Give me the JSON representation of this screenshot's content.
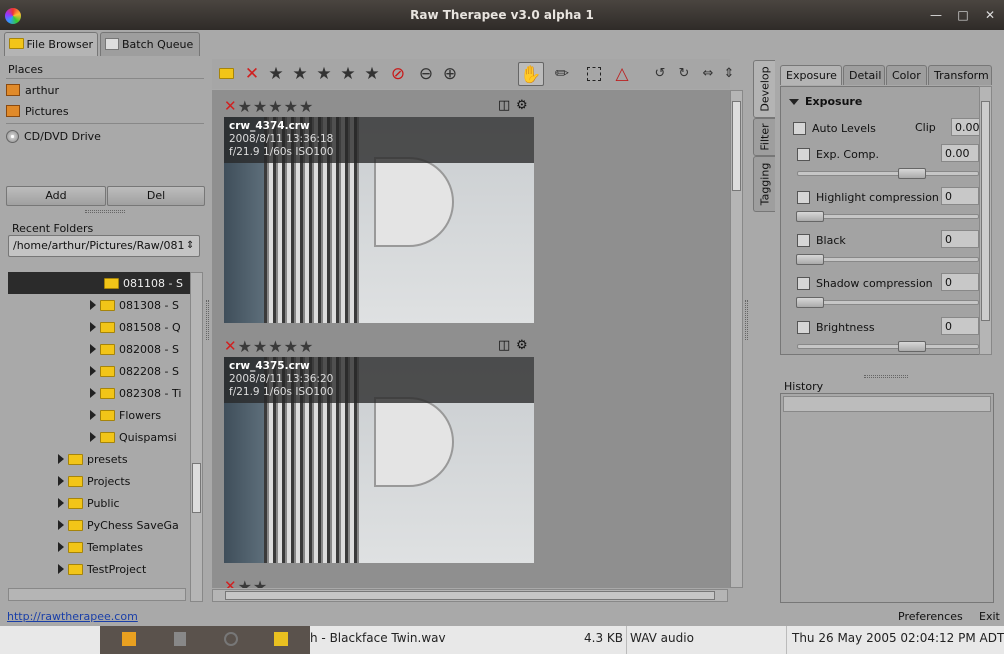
{
  "window": {
    "title": "Raw Therapee v3.0 alpha 1"
  },
  "tabs": {
    "file_browser": "File Browser",
    "batch_queue": "Batch Queue"
  },
  "places": {
    "header": "Places",
    "items": [
      "arthur",
      "Pictures",
      "CD/DVD Drive"
    ],
    "add_label": "Add",
    "del_label": "Del"
  },
  "recent": {
    "header": "Recent Folders",
    "value": "/home/arthur/Pictures/Raw/081"
  },
  "tree": {
    "items": [
      "081108 - S",
      "081308 - S",
      "081508 - Q",
      "082008 - S",
      "082208 - S",
      "082308 - Ti",
      "Flowers",
      "Quispamsi",
      "presets",
      "Projects",
      "Public",
      "PyChess SaveGa",
      "Templates",
      "TestProject"
    ]
  },
  "thumbs": [
    {
      "name": "crw_4374.crw",
      "date": "2008/8/11 13:36:18",
      "exif": "f/21.9 1/60s ISO100"
    },
    {
      "name": "crw_4375.crw",
      "date": "2008/8/11 13:36:20",
      "exif": "f/21.9 1/60s ISO100"
    }
  ],
  "side_tabs": {
    "develop": "Develop",
    "filter": "Filter",
    "tagging": "Tagging"
  },
  "tool_tabs": {
    "exposure": "Exposure",
    "detail": "Detail",
    "color": "Color",
    "transform": "Transform"
  },
  "exposure": {
    "header": "Exposure",
    "auto_levels": "Auto Levels",
    "clip_label": "Clip",
    "clip_value": "0.00",
    "exp_comp": "Exp. Comp.",
    "exp_comp_value": "0.00",
    "highlight": "Highlight compression",
    "highlight_value": "0",
    "black": "Black",
    "black_value": "0",
    "shadow": "Shadow compression",
    "shadow_value": "0",
    "brightness": "Brightness",
    "brightness_value": "0"
  },
  "history": {
    "header": "History"
  },
  "status": {
    "link": "http://rawtherapee.com",
    "preferences": "Preferences",
    "exit": "Exit"
  },
  "taskbar": {
    "file": "h - Blackface Twin.wav",
    "size": "4.3 KB",
    "type": "WAV audio",
    "date": "Thu 26 May 2005 02:04:12 PM ADT"
  },
  "colors": {
    "accent": "#3a6ea5",
    "reject": "#d02020",
    "folder": "#f2c518"
  }
}
